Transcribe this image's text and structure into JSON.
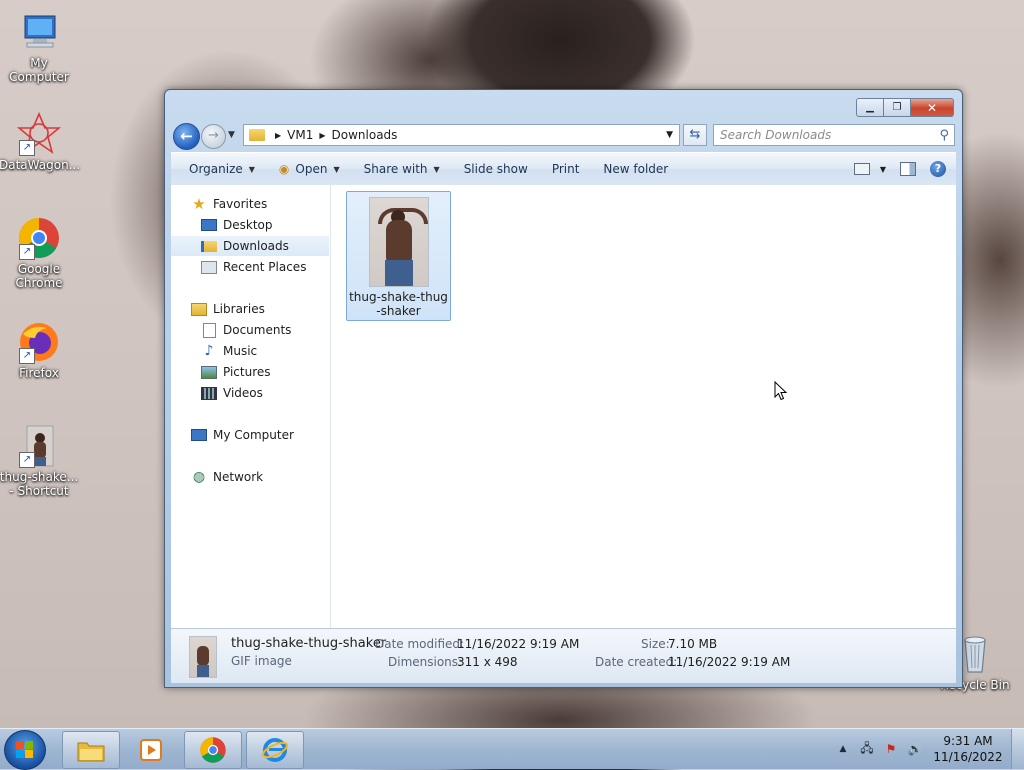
{
  "desktop": {
    "icons": [
      {
        "label": "My Computer"
      },
      {
        "label": "DataWagon..."
      },
      {
        "label": "Google Chrome"
      },
      {
        "label": "Firefox"
      },
      {
        "label": "thug-shake... - Shortcut"
      },
      {
        "label": "Recycle Bin"
      }
    ]
  },
  "window": {
    "breadcrumb": [
      "VM1",
      "Downloads"
    ],
    "search_placeholder": "Search Downloads",
    "toolbar": {
      "organize": "Organize",
      "open": "Open",
      "share_with": "Share with",
      "slide_show": "Slide show",
      "print": "Print",
      "new_folder": "New folder"
    },
    "nav": {
      "favorites": "Favorites",
      "desktop": "Desktop",
      "downloads": "Downloads",
      "recent_places": "Recent Places",
      "libraries": "Libraries",
      "documents": "Documents",
      "music": "Music",
      "pictures": "Pictures",
      "videos": "Videos",
      "my_computer": "My Computer",
      "network": "Network"
    },
    "file": {
      "name_line1": "thug-shake-thug",
      "name_line2": "-shaker"
    },
    "details": {
      "name": "thug-shake-thug-shaker",
      "type": "GIF image",
      "date_modified_label": "Date modified:",
      "date_modified": "11/16/2022 9:19 AM",
      "dimensions_label": "Dimensions:",
      "dimensions": "311 x 498",
      "size_label": "Size:",
      "size": "7.10 MB",
      "date_created_label": "Date created:",
      "date_created": "11/16/2022 9:19 AM"
    }
  },
  "taskbar": {
    "time": "9:31 AM",
    "date": "11/16/2022"
  }
}
